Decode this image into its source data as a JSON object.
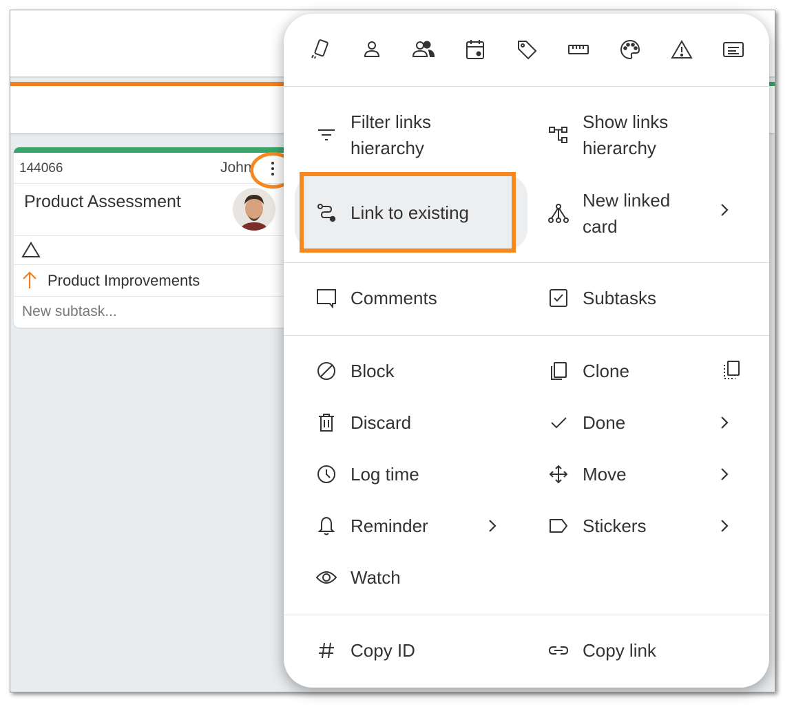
{
  "card": {
    "id": "144066",
    "owner": "John",
    "title": "Product Assessment",
    "parent": "Product Improvements",
    "subtask_placeholder": "New subtask..."
  },
  "icon_bar": [
    "card-type-icon",
    "user-icon",
    "users-icon",
    "calendar-icon",
    "tag-icon",
    "ruler-icon",
    "palette-icon",
    "warning-icon",
    "text-icon"
  ],
  "menu": {
    "filter_links_line1": "Filter links",
    "filter_links_line2": "hierarchy",
    "show_links_line1": "Show links",
    "show_links_line2": "hierarchy",
    "link_existing": "Link to existing",
    "new_linked_line1": "New linked",
    "new_linked_line2": "card",
    "comments": "Comments",
    "subtasks": "Subtasks",
    "block": "Block",
    "clone": "Clone",
    "discard": "Discard",
    "done": "Done",
    "log_time": "Log time",
    "move": "Move",
    "reminder": "Reminder",
    "stickers": "Stickers",
    "watch": "Watch",
    "copy_id": "Copy ID",
    "copy_link": "Copy link"
  },
  "colors": {
    "highlight": "#f6881f",
    "card_bar": "#3aa56b",
    "lane_line": "#f07f22"
  }
}
